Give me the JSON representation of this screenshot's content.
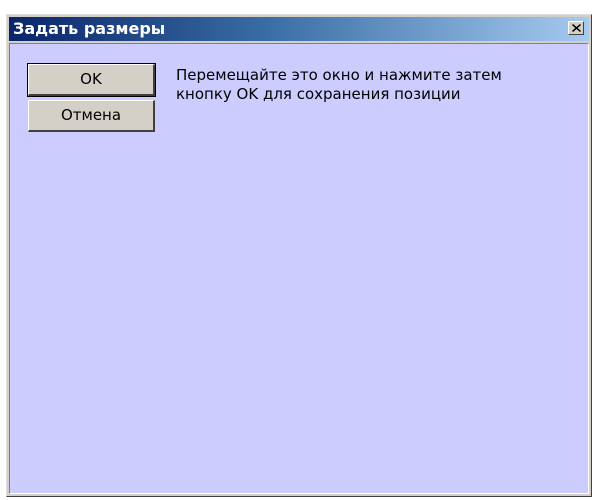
{
  "window": {
    "title": "Задать размеры"
  },
  "buttons": {
    "ok_label": "OK",
    "cancel_label": "Отмена"
  },
  "message": {
    "line1": "Перемещайте это окно и нажмите затем",
    "line2": "кнопку OK для сохранения позиции"
  },
  "icons": {
    "close": "close-icon"
  },
  "colors": {
    "title_bar_start": "#0a246a",
    "title_bar_end": "#a6caf0",
    "client_background": "#ccccff",
    "button_face": "#d4d0c8"
  }
}
